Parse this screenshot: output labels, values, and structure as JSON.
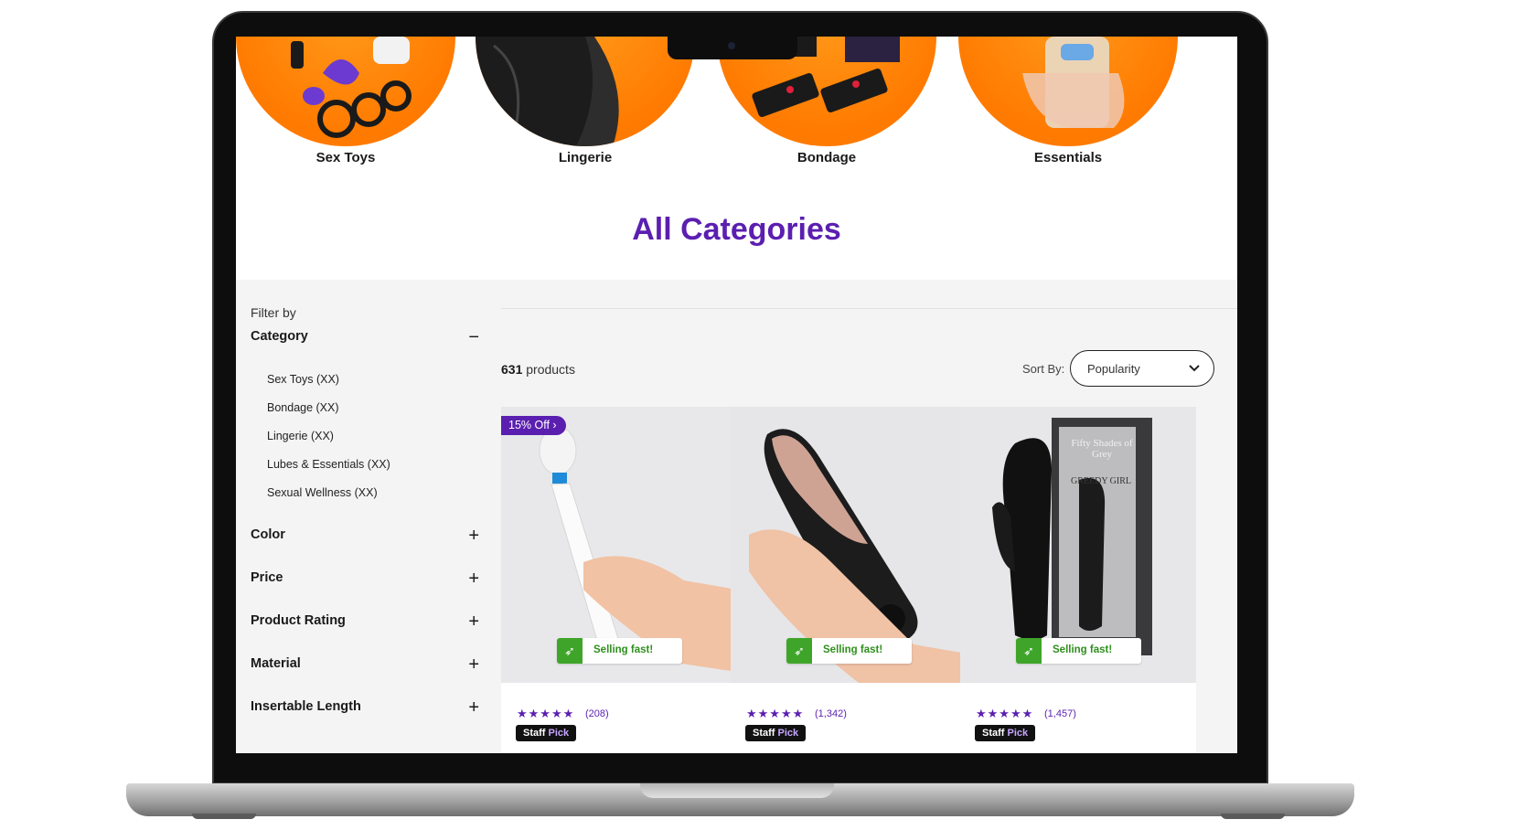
{
  "categories": [
    {
      "label": "Sex Toys",
      "icon": "toys-photo-icon"
    },
    {
      "label": "Lingerie",
      "icon": "lingerie-photo-icon"
    },
    {
      "label": "Bondage",
      "icon": "bondage-photo-icon"
    },
    {
      "label": "Essentials",
      "icon": "essentials-photo-icon"
    }
  ],
  "page_title": "All Categories",
  "sidebar": {
    "filter_by": "Filter by",
    "category": {
      "label": "Category",
      "toggle": "−",
      "items": [
        "Sex Toys (XX)",
        "Bondage (XX)",
        "Lingerie (XX)",
        "Lubes & Essentials (XX)",
        "Sexual Wellness (XX)"
      ]
    },
    "filters": [
      {
        "label": "Color",
        "toggle": "+"
      },
      {
        "label": "Price",
        "toggle": "+"
      },
      {
        "label": "Product Rating",
        "toggle": "+"
      },
      {
        "label": "Material",
        "toggle": "+"
      },
      {
        "label": "Insertable Length",
        "toggle": "+"
      }
    ]
  },
  "results": {
    "count": "631",
    "count_suffix": " products",
    "sort_label": "Sort By:",
    "sort_value": "Popularity"
  },
  "products": [
    {
      "discount": "15% Off ›",
      "badge": "Selling fast!",
      "stars": "★★★★★",
      "reviews": "(208)",
      "staff_a": "Staff",
      "staff_b": "Pick"
    },
    {
      "discount": "",
      "badge": "Selling fast!",
      "stars": "★★★★★",
      "reviews": "(1,342)",
      "staff_a": "Staff",
      "staff_b": "Pick"
    },
    {
      "discount": "",
      "badge": "Selling fast!",
      "stars": "★★★★★",
      "reviews": "(1,457)",
      "staff_a": "Staff",
      "staff_b": "Pick",
      "box_text_1": "Fifty Shades of Grey",
      "box_text_2": "GREEDY GIRL"
    }
  ],
  "colors": {
    "accent": "#5b1fb0",
    "orange": "#ff7a00",
    "success": "#3fa52a"
  }
}
